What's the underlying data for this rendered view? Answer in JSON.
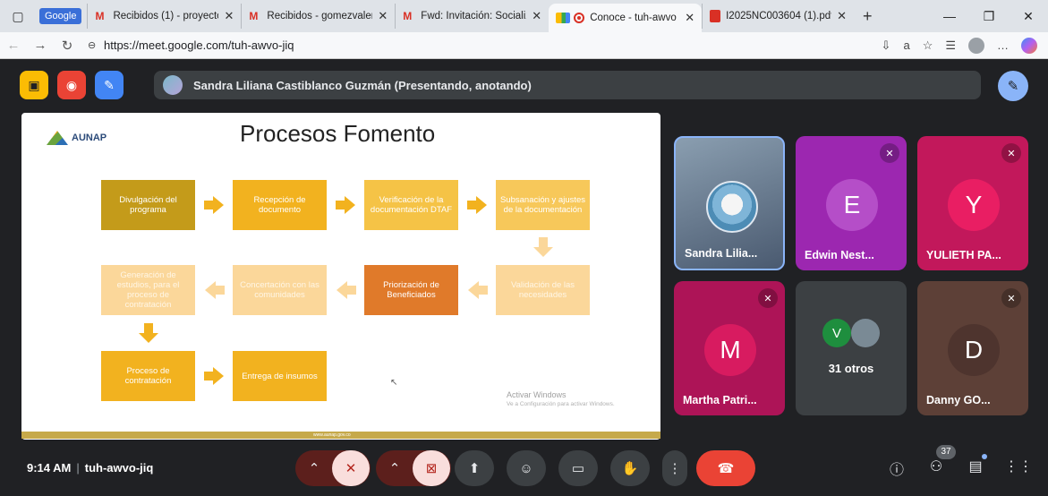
{
  "browser": {
    "google_badge": "Google",
    "tabs": [
      {
        "title": "Recibidos (1) - proyecto"
      },
      {
        "title": "Recibidos - gomezvalen"
      },
      {
        "title": "Fwd: Invitación: Socializ"
      },
      {
        "title": "Conoce - tuh-awvo"
      },
      {
        "title": "I2025NC003604 (1).pdf"
      }
    ],
    "url_prefix": "https://",
    "url_host": "meet.google.com",
    "url_path": "/tuh-awvo-jiq"
  },
  "meet": {
    "presenter_text": "Sandra Liliana Castiblanco Guzmán (Presentando, anotando)",
    "time": "9:14 AM",
    "meeting_code": "tuh-awvo-jiq",
    "participants_count": "37"
  },
  "slide": {
    "logo_text": "AUNAP",
    "title": "Procesos Fomento",
    "steps": [
      "Divulgación del programa",
      "Recepción de documento",
      "Verificación de la documentación DTAF",
      "Subsanación y ajustes de la documentación",
      "Validación de las necesidades",
      "Priorización de Beneficiados",
      "Concertación con las comunidades",
      "Generación de estudios, para el proceso de contratación",
      "Proceso de contratación",
      "Entrega de insumos"
    ],
    "footer_url": "www.aunap.gov.co",
    "watermark_title": "Activar Windows",
    "watermark_sub": "Ve a Configuración para activar Windows."
  },
  "tiles": [
    {
      "name": "Sandra Lilia...",
      "initial": ""
    },
    {
      "name": "Edwin Nest...",
      "initial": "E"
    },
    {
      "name": "YULIETH PA...",
      "initial": "Y"
    },
    {
      "name": "Martha Patri...",
      "initial": "M"
    },
    {
      "name": "",
      "initial": "V",
      "others": "31 otros"
    },
    {
      "name": "Danny GO...",
      "initial": "D"
    }
  ],
  "colors": {
    "accent": "#8ab4f8",
    "hangup": "#ea4335",
    "slide_gold": "#f2b21f",
    "slide_dark_gold": "#c49b1a",
    "slide_orange": "#e07a2a"
  }
}
